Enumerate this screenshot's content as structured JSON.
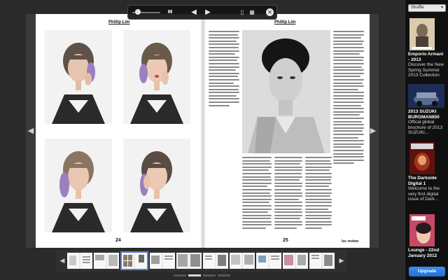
{
  "toolbar": {
    "slider_icon": "zoom-slider",
    "grid_icon": "two-page-icon",
    "prev_icon": "play-left-icon",
    "next_icon": "play-right-icon",
    "share_icon": "share-icon",
    "save_icon": "library-icon",
    "close_icon": "close-icon",
    "prev_glyph": "◀",
    "next_glyph": "▶",
    "close_glyph": "✕",
    "grid_glyph": "▮▮",
    "share_glyph": "▯",
    "save_glyph": "▦"
  },
  "spread": {
    "left_header": "Phillip Lim",
    "right_header": "Phillip Lim",
    "left_page_number": "24",
    "right_page_number": "25",
    "brand": "lsc review"
  },
  "nav": {
    "left_glyph": "◀",
    "right_glyph": "▶"
  },
  "thumbstrip": {
    "left_glyph": "◀",
    "right_glyph": "▶",
    "selected_index": 2,
    "count": 10
  },
  "sidebar": {
    "shuffle_label": "Shuffle",
    "shuffle_caret": "▾",
    "items": [
      {
        "title": "Emporio Armani - 2013",
        "desc": "Discover the New Spring Summer 2013 Collection",
        "cover_color": "#c8b48a"
      },
      {
        "title": "2013 SUZUKI BURGMAN650",
        "desc": "Offical global brochure of 2013 SUZUKI...",
        "cover_color": "#2a3a6a"
      },
      {
        "title": "The Darkside Digital 1",
        "desc": "Welcome to the very first digital issue of Dark...",
        "cover_color": "#7a1a12"
      },
      {
        "title": "Lounge - 22nd January 2012",
        "desc": "",
        "cover_color": "#b43c5a"
      }
    ],
    "upgrade_label": "Upgrade"
  }
}
